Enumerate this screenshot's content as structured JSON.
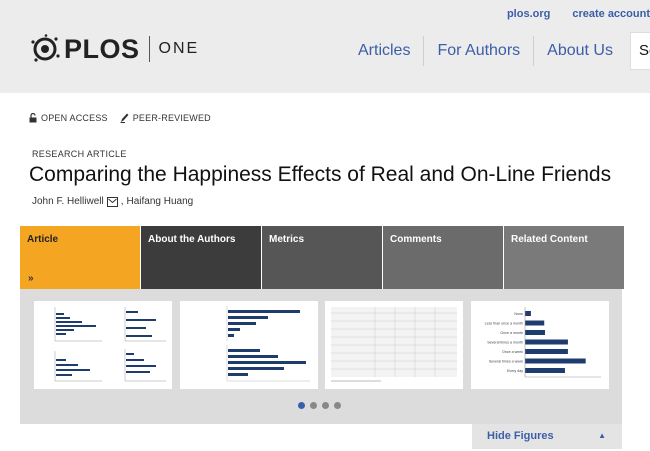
{
  "header": {
    "top_links": [
      "plos.org",
      "create account"
    ],
    "logo_text": "PLOS",
    "logo_sub": "ONE",
    "nav": [
      "Articles",
      "For Authors",
      "About Us"
    ],
    "search_text": "Se"
  },
  "badges": {
    "open_access": "OPEN ACCESS",
    "peer_reviewed": "PEER-REVIEWED"
  },
  "article": {
    "type": "RESEARCH ARTICLE",
    "title": "Comparing the Happiness Effects of Real and On-Line Friends",
    "author1": "John F. Helliwell",
    "author_sep": ",",
    "author2": "Haifang Huang"
  },
  "tabs": [
    "Article",
    "About the Authors",
    "Metrics",
    "Comments",
    "Related Content"
  ],
  "figures": {
    "thumb4_labels": [
      "None",
      "Less than once a month",
      "Once a month",
      "Several times a month",
      "Once a week",
      "Several times a week",
      "Every day"
    ],
    "thumb4_values": [
      0.8,
      2.6,
      2.7,
      5.8,
      5.8,
      8.2,
      5.4
    ],
    "hide_label": "Hide Figures"
  },
  "colors": {
    "accent": "#f4a623",
    "link": "#3b5ea8",
    "bar": "#1f3c6e"
  }
}
